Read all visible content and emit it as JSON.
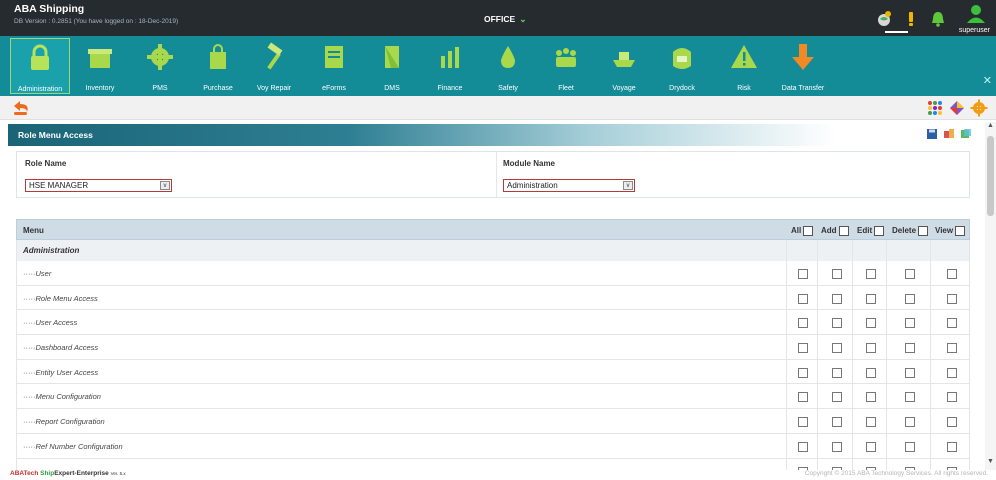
{
  "app": {
    "brand": "ABA Shipping",
    "db_version": "DB Version : 0.2851 (You have logged on : 18-Dec-2019)",
    "office": "OFFICE",
    "username": "superuser"
  },
  "modules": [
    {
      "label": "Administration",
      "icon": "padlock-icon",
      "active": true
    },
    {
      "label": "Inventory",
      "icon": "inventory-icon"
    },
    {
      "label": "PMS",
      "icon": "gear-icon"
    },
    {
      "label": "Purchase",
      "icon": "shopping-bag-icon"
    },
    {
      "label": "Voy Repair",
      "icon": "hammer-icon"
    },
    {
      "label": "eForms",
      "icon": "eforms-icon"
    },
    {
      "label": "DMS",
      "icon": "document-icon"
    },
    {
      "label": "Finance",
      "icon": "finance-icon"
    },
    {
      "label": "Safety",
      "icon": "safety-icon"
    },
    {
      "label": "Fleet",
      "icon": "fleet-icon"
    },
    {
      "label": "Voyage",
      "icon": "ship-icon"
    },
    {
      "label": "Drydock",
      "icon": "drydock-icon"
    },
    {
      "label": "Risk",
      "icon": "warning-icon"
    },
    {
      "label": "Data Transfer",
      "icon": "download-arrow-icon"
    }
  ],
  "page": {
    "title": "Role Menu Access"
  },
  "form": {
    "role_label": "Role Name",
    "role_value": "HSE MANAGER",
    "module_label": "Module Name",
    "module_value": "Administration"
  },
  "table": {
    "menu_header": "Menu",
    "columns": [
      "All",
      "Add",
      "Edit",
      "Delete",
      "View"
    ],
    "group": "Administration",
    "rows": [
      "·····User",
      "·····Role Menu Access",
      "·····User Access",
      "·····Dashboard Access",
      "·····Entity User Access",
      "·····Menu Configuration",
      "·····Report Configuration",
      "·····Ref Number Configuration",
      "·····"
    ]
  },
  "footer": {
    "brand_a": "ABATech ",
    "brand_b": "Ship",
    "brand_c": "Expert-",
    "brand_d": "Enterprise",
    "version": "Ver. 5.x",
    "copyright": "Copyright © 2015 ABA Technology Services. All rights reserved."
  },
  "colors": {
    "module_bar": "#138c97",
    "top_bar": "#262b30",
    "accent_green": "#6fd04a",
    "select_border": "#b23b3b"
  }
}
